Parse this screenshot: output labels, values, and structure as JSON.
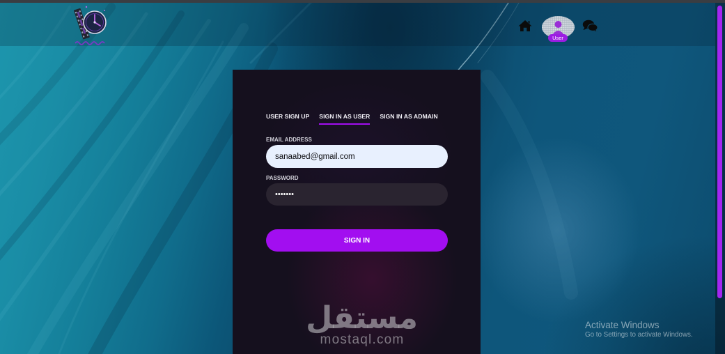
{
  "icons": {
    "logo": "clock-film-logo",
    "home": "home-icon",
    "user": "user-icon",
    "chat": "chat-icon"
  },
  "nav": {
    "user_badge": "User"
  },
  "auth": {
    "tabs": [
      {
        "label": "USER SIGN UP",
        "active": false
      },
      {
        "label": "SIGN IN AS USER",
        "active": true
      },
      {
        "label": "SIGN IN AS ADMAIN",
        "active": false
      }
    ],
    "email_label": "EMAIL ADDRESS",
    "email_value": "sanaabed@gmail.com",
    "password_label": "PASSWORD",
    "password_masked": "•••••••",
    "submit_label": "SIGN IN"
  },
  "watermark": {
    "arabic": "مستقل",
    "domain": "mostaql.com"
  },
  "os_notice": {
    "title": "Activate Windows",
    "subtitle": "Go to Settings to activate Windows."
  },
  "colors": {
    "accent": "#a20ef0",
    "panel": "#15101e",
    "email_field_bg": "#e8f0fe",
    "badge": "#9c1de3"
  }
}
